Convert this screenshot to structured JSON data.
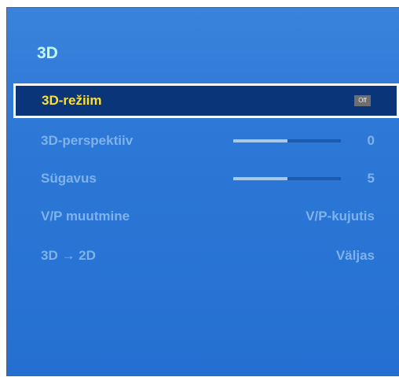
{
  "title": "3D",
  "items": [
    {
      "label": "3D-režiim",
      "toggle": "Off"
    },
    {
      "label": "3D-perspektiiv",
      "value": "0",
      "slider_fraction": 0.5
    },
    {
      "label": "Sügavus",
      "value": "5",
      "slider_fraction": 0.5
    },
    {
      "label": "V/P muutmine",
      "value": "V/P-kujutis"
    },
    {
      "label": "3D → 2D",
      "value": "Väljas"
    }
  ]
}
